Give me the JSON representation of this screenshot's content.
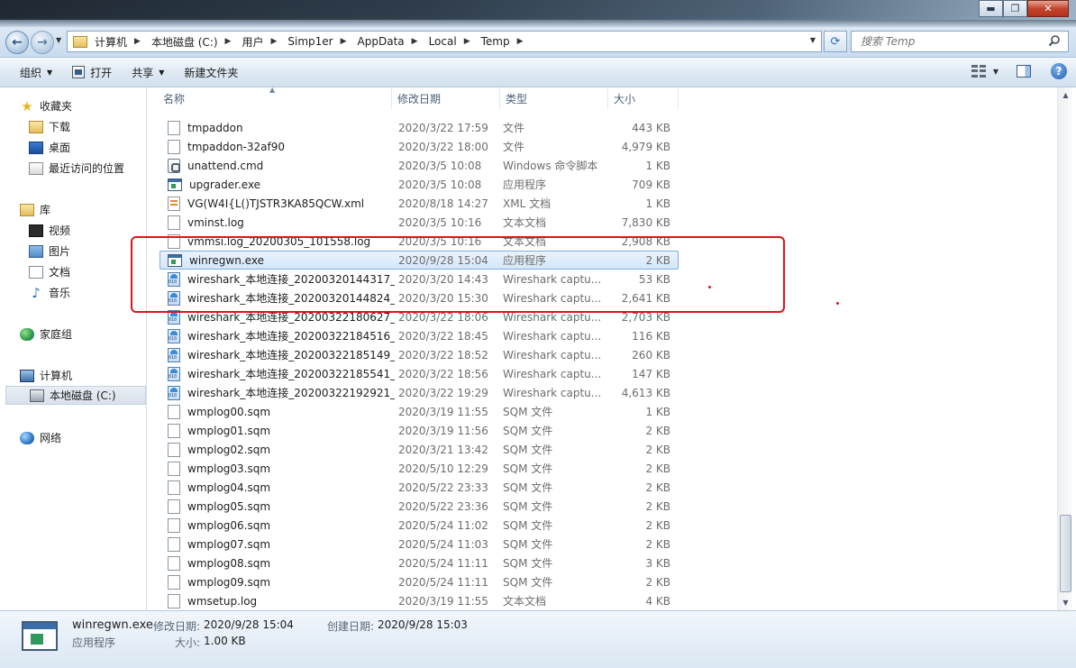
{
  "window": {
    "min_label": "▬",
    "max_label": "❐",
    "close_label": "✕"
  },
  "address": {
    "crumbs": [
      "计算机",
      "本地磁盘 (C:)",
      "用户",
      "Simp1er",
      "AppData",
      "Local",
      "Temp"
    ]
  },
  "search": {
    "placeholder": "搜索 Temp"
  },
  "toolbar": {
    "organize": "组织",
    "open": "打开",
    "share": "共享",
    "new_folder": "新建文件夹"
  },
  "sidebar": {
    "favorites": "收藏夹",
    "downloads": "下载",
    "desktop": "桌面",
    "recent": "最近访问的位置",
    "libraries": "库",
    "videos": "视频",
    "pictures": "图片",
    "documents": "文档",
    "music": "音乐",
    "homegroup": "家庭组",
    "computer": "计算机",
    "local_disk": "本地磁盘 (C:)",
    "network": "网络"
  },
  "columns": {
    "name": "名称",
    "date": "修改日期",
    "type": "类型",
    "size": "大小"
  },
  "files": [
    {
      "icon": "generic",
      "name": "tmpaddon",
      "date": "2020/3/22 17:59",
      "type": "文件",
      "size": "443 KB"
    },
    {
      "icon": "generic",
      "name": "tmpaddon-32af90",
      "date": "2020/3/22 18:00",
      "type": "文件",
      "size": "4,979 KB"
    },
    {
      "icon": "cmd",
      "name": "unattend.cmd",
      "date": "2020/3/5 10:08",
      "type": "Windows 命令脚本",
      "size": "1 KB"
    },
    {
      "icon": "exe",
      "name": "upgrader.exe",
      "date": "2020/3/5 10:08",
      "type": "应用程序",
      "size": "709 KB"
    },
    {
      "icon": "xml",
      "name": "VG(W4I{L()TJSTR3KA85QCW.xml",
      "date": "2020/8/18 14:27",
      "type": "XML 文档",
      "size": "1 KB"
    },
    {
      "icon": "generic",
      "name": "vminst.log",
      "date": "2020/3/5 10:16",
      "type": "文本文档",
      "size": "7,830 KB"
    },
    {
      "icon": "generic",
      "name": "vmmsi.log_20200305_101558.log",
      "date": "2020/3/5 10:16",
      "type": "文本文档",
      "size": "2,908 KB"
    },
    {
      "icon": "exe",
      "name": "winregwn.exe",
      "date": "2020/9/28 15:04",
      "type": "应用程序",
      "size": "2 KB"
    },
    {
      "icon": "pcap",
      "name": "wireshark_本地连接_20200320144317_...",
      "date": "2020/3/20 14:43",
      "type": "Wireshark captu...",
      "size": "53 KB"
    },
    {
      "icon": "pcap",
      "name": "wireshark_本地连接_20200320144824_...",
      "date": "2020/3/20 15:30",
      "type": "Wireshark captu...",
      "size": "2,641 KB"
    },
    {
      "icon": "pcap",
      "name": "wireshark_本地连接_20200322180627_...",
      "date": "2020/3/22 18:06",
      "type": "Wireshark captu...",
      "size": "2,703 KB"
    },
    {
      "icon": "pcap",
      "name": "wireshark_本地连接_20200322184516_...",
      "date": "2020/3/22 18:45",
      "type": "Wireshark captu...",
      "size": "116 KB"
    },
    {
      "icon": "pcap",
      "name": "wireshark_本地连接_20200322185149_...",
      "date": "2020/3/22 18:52",
      "type": "Wireshark captu...",
      "size": "260 KB"
    },
    {
      "icon": "pcap",
      "name": "wireshark_本地连接_20200322185541_...",
      "date": "2020/3/22 18:56",
      "type": "Wireshark captu...",
      "size": "147 KB"
    },
    {
      "icon": "pcap",
      "name": "wireshark_本地连接_20200322192921_...",
      "date": "2020/3/22 19:29",
      "type": "Wireshark captu...",
      "size": "4,613 KB"
    },
    {
      "icon": "generic",
      "name": "wmplog00.sqm",
      "date": "2020/3/19 11:55",
      "type": "SQM 文件",
      "size": "1 KB"
    },
    {
      "icon": "generic",
      "name": "wmplog01.sqm",
      "date": "2020/3/19 11:56",
      "type": "SQM 文件",
      "size": "2 KB"
    },
    {
      "icon": "generic",
      "name": "wmplog02.sqm",
      "date": "2020/3/21 13:42",
      "type": "SQM 文件",
      "size": "2 KB"
    },
    {
      "icon": "generic",
      "name": "wmplog03.sqm",
      "date": "2020/5/10 12:29",
      "type": "SQM 文件",
      "size": "2 KB"
    },
    {
      "icon": "generic",
      "name": "wmplog04.sqm",
      "date": "2020/5/22 23:33",
      "type": "SQM 文件",
      "size": "2 KB"
    },
    {
      "icon": "generic",
      "name": "wmplog05.sqm",
      "date": "2020/5/22 23:36",
      "type": "SQM 文件",
      "size": "2 KB"
    },
    {
      "icon": "generic",
      "name": "wmplog06.sqm",
      "date": "2020/5/24 11:02",
      "type": "SQM 文件",
      "size": "2 KB"
    },
    {
      "icon": "generic",
      "name": "wmplog07.sqm",
      "date": "2020/5/24 11:03",
      "type": "SQM 文件",
      "size": "2 KB"
    },
    {
      "icon": "generic",
      "name": "wmplog08.sqm",
      "date": "2020/5/24 11:11",
      "type": "SQM 文件",
      "size": "3 KB"
    },
    {
      "icon": "generic",
      "name": "wmplog09.sqm",
      "date": "2020/5/24 11:11",
      "type": "SQM 文件",
      "size": "2 KB"
    },
    {
      "icon": "generic",
      "name": "wmsetup.log",
      "date": "2020/3/19 11:55",
      "type": "文本文档",
      "size": "4 KB"
    }
  ],
  "details": {
    "name": "winregwn.exe",
    "modified_label": "修改日期:",
    "modified": "2020/9/28 15:04",
    "created_label": "创建日期:",
    "created": "2020/9/28 15:03",
    "type": "应用程序",
    "size_label": "大小:",
    "size": "1.00 KB"
  },
  "colors": {
    "highlight_box": "#e0141b",
    "selection": "#d5e7fa"
  }
}
